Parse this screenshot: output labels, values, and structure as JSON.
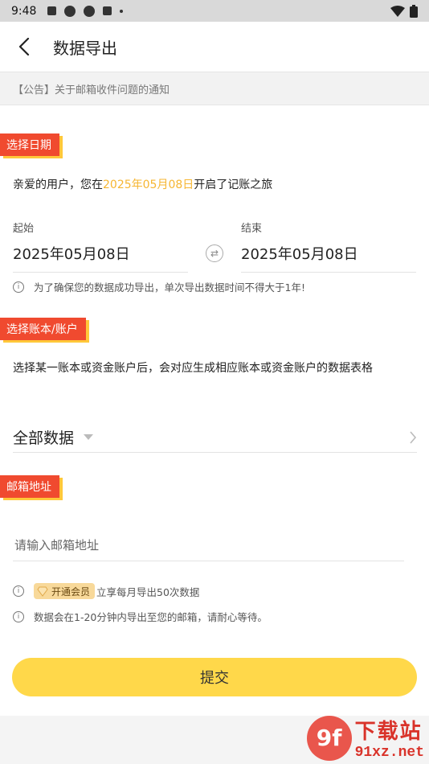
{
  "statusbar": {
    "time": "9:48"
  },
  "header": {
    "title": "数据导出"
  },
  "notice": {
    "text": "【公告】关于邮箱收件问题的通知"
  },
  "section_date": {
    "tag": "选择日期",
    "greeting_prefix": "亲爱的用户，您在",
    "greeting_date": "2025年05月08日",
    "greeting_suffix": "开启了记账之旅",
    "start_label": "起始",
    "start_value": "2025年05月08日",
    "end_label": "结束",
    "end_value": "2025年05月08日",
    "hint": "为了确保您的数据成功导出，单次导出数据时间不得大于1年!"
  },
  "section_book": {
    "tag": "选择账本/账户",
    "desc": "选择某一账本或资金账户后，会对应生成相应账本或资金账户的数据表格",
    "selected": "全部数据"
  },
  "section_email": {
    "tag": "邮箱地址",
    "placeholder": "请输入邮箱地址",
    "vip_badge": "开通会员",
    "vip_text": "立享每月导出50次数据",
    "delay_text": "数据会在1-20分钟内导出至您的邮箱，请耐心等待。"
  },
  "submit": {
    "label": "提交"
  },
  "watermark": {
    "logo": "9f",
    "title": "下载站",
    "url": "91xz.net"
  },
  "colors": {
    "accent": "#ffd84a",
    "tag": "#f04a2f",
    "highlight": "#f6b632"
  }
}
